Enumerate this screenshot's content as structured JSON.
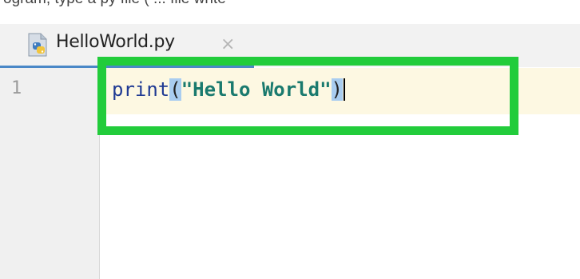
{
  "top_fragment": "ogram, type a py file ( ... file write",
  "tab": {
    "filename": "HelloWorld.py",
    "close_symbol": "×",
    "icon": "python-file-icon"
  },
  "editor": {
    "line_number": "1",
    "code": {
      "function": "print",
      "open_paren": "(",
      "string": "\"Hello World\"",
      "close_paren": ")"
    }
  },
  "colors": {
    "annotation_box": "#22cc3b",
    "current_line": "#fdf8e2",
    "tab_underline": "#4a88c7",
    "string": "#1a7a6e",
    "function": "#1f3a93"
  }
}
